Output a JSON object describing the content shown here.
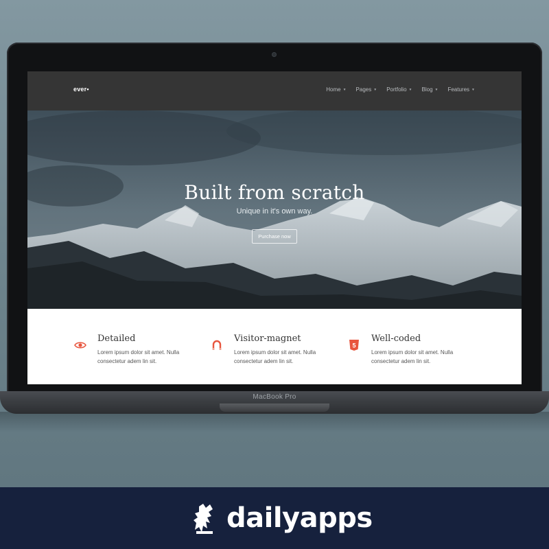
{
  "nav": {
    "logo": "ever•",
    "items": [
      {
        "label": "Home"
      },
      {
        "label": "Pages"
      },
      {
        "label": "Portfolio"
      },
      {
        "label": "Blog"
      },
      {
        "label": "Features"
      }
    ]
  },
  "hero": {
    "title": "Built from scratch",
    "subtitle": "Unique in it's own way.",
    "button_label": "Purchase now"
  },
  "features": [
    {
      "title": "Detailed",
      "text": "Lorem ipsum dolor sit amet. Nulla consectetur adem lin sit.",
      "icon": "eye-icon"
    },
    {
      "title": "Visitor-magnet",
      "text": "Lorem ipsum dolor sit amet. Nulla consectetur adem lin sit.",
      "icon": "magnet-icon"
    },
    {
      "title": "Well-coded",
      "text": "Lorem ipsum dolor sit amet. Nulla consectetur adem lin sit.",
      "icon": "html5-icon"
    }
  ],
  "device": {
    "label": "MacBook Pro"
  },
  "footer": {
    "brand": "dailyapps"
  },
  "colors": {
    "accent": "#e8553e",
    "nav_bg": "#353535",
    "footer_bg": "#16213d"
  }
}
